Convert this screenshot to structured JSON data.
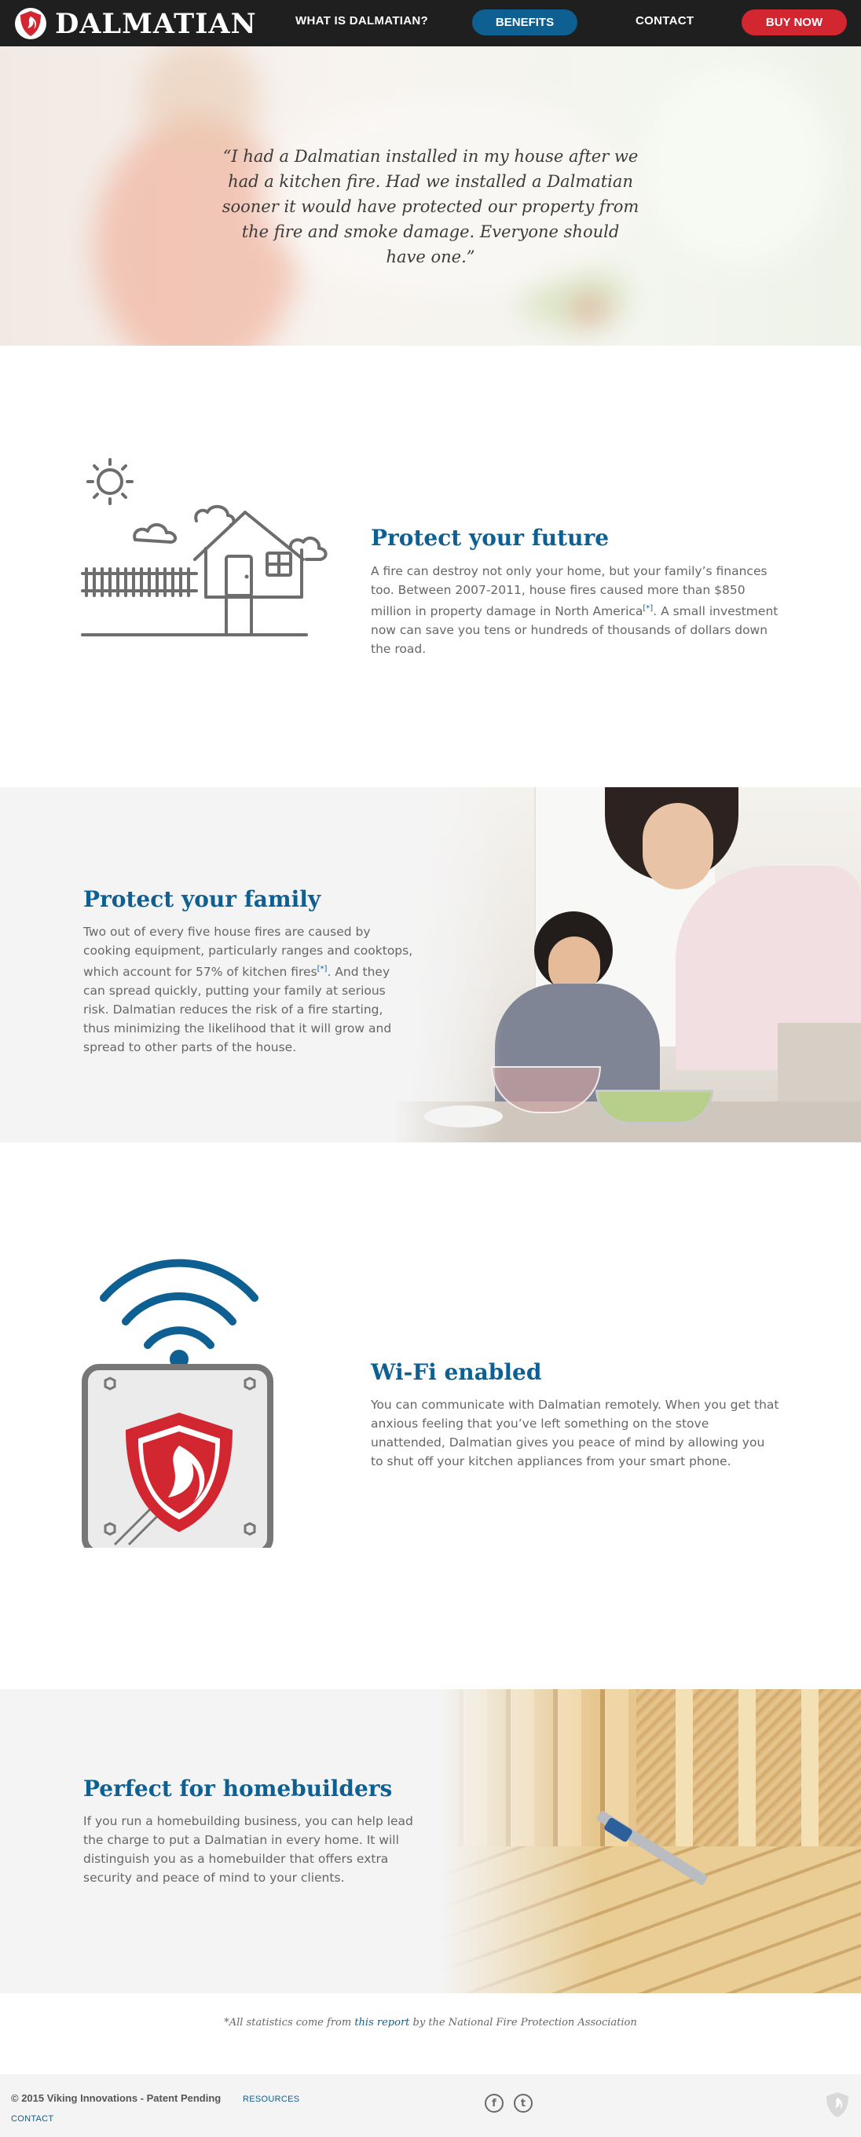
{
  "nav": {
    "brand": "DALMATIAN",
    "links": [
      {
        "label": "WHAT IS DALMATIAN?"
      },
      {
        "label": "BENEFITS"
      },
      {
        "label": "CONTACT"
      },
      {
        "label": "BUY NOW"
      }
    ],
    "accent_color": "#0e5f92",
    "buy_color": "#d22630"
  },
  "hero": {
    "quote": "“I had a Dalmatian installed in my house after we had a kitchen fire. Had we installed a Dalmatian sooner it would have protected our property from the fire and smoke damage. Everyone should have one.”"
  },
  "sections": [
    {
      "title": "Protect your future",
      "body_before": "A fire can destroy not only your home, but your family’s finances too. Between 2007-2011, house fires caused more than $850 million in property damage in North America",
      "ref": "[*]",
      "body_after": ". A small investment now can save you tens or hundreds of thousands of dollars down the road.",
      "icon": "house-icon"
    },
    {
      "title": "Protect your family",
      "body_before": "Two out of every five house fires are caused by cooking equipment, particularly ranges and cooktops, which account for 57% of kitchen fires",
      "ref": "[*]",
      "body_after": ". And they can spread quickly, putting your family at serious risk. Dalmatian reduces the risk of a fire starting, thus minimizing the likelihood that it will grow and spread to other parts of the house.",
      "image": "mother-and-son-cooking-photo"
    },
    {
      "title": "Wi-Fi enabled",
      "body": "You can communicate with Dalmatian remotely. When you get that anxious feeling that you’ve left something on the stove unattended, Dalmatian gives you peace of mind by allowing you to shut off your kitchen appliances from your smart phone.",
      "icon": "wifi-device-icon"
    },
    {
      "title": "Perfect for homebuilders",
      "body": "If you run a homebuilding business, you can help lead the charge to put a Dalmatian in every home. It will distinguish you as a homebuilder that offers extra security and peace of mind to your clients.",
      "image": "house-framing-lumber-photo"
    }
  ],
  "footnote": {
    "before": "*All statistics come from ",
    "link": "this report",
    "after": " by the National Fire Protection Association"
  },
  "footer": {
    "copyright": "© 2015 Viking Innovations - Patent Pending",
    "resources": "RESOURCES",
    "contact": "CONTACT",
    "social": [
      {
        "icon": "facebook-icon",
        "glyph": "f"
      },
      {
        "icon": "twitter-icon",
        "glyph": "t"
      }
    ]
  }
}
